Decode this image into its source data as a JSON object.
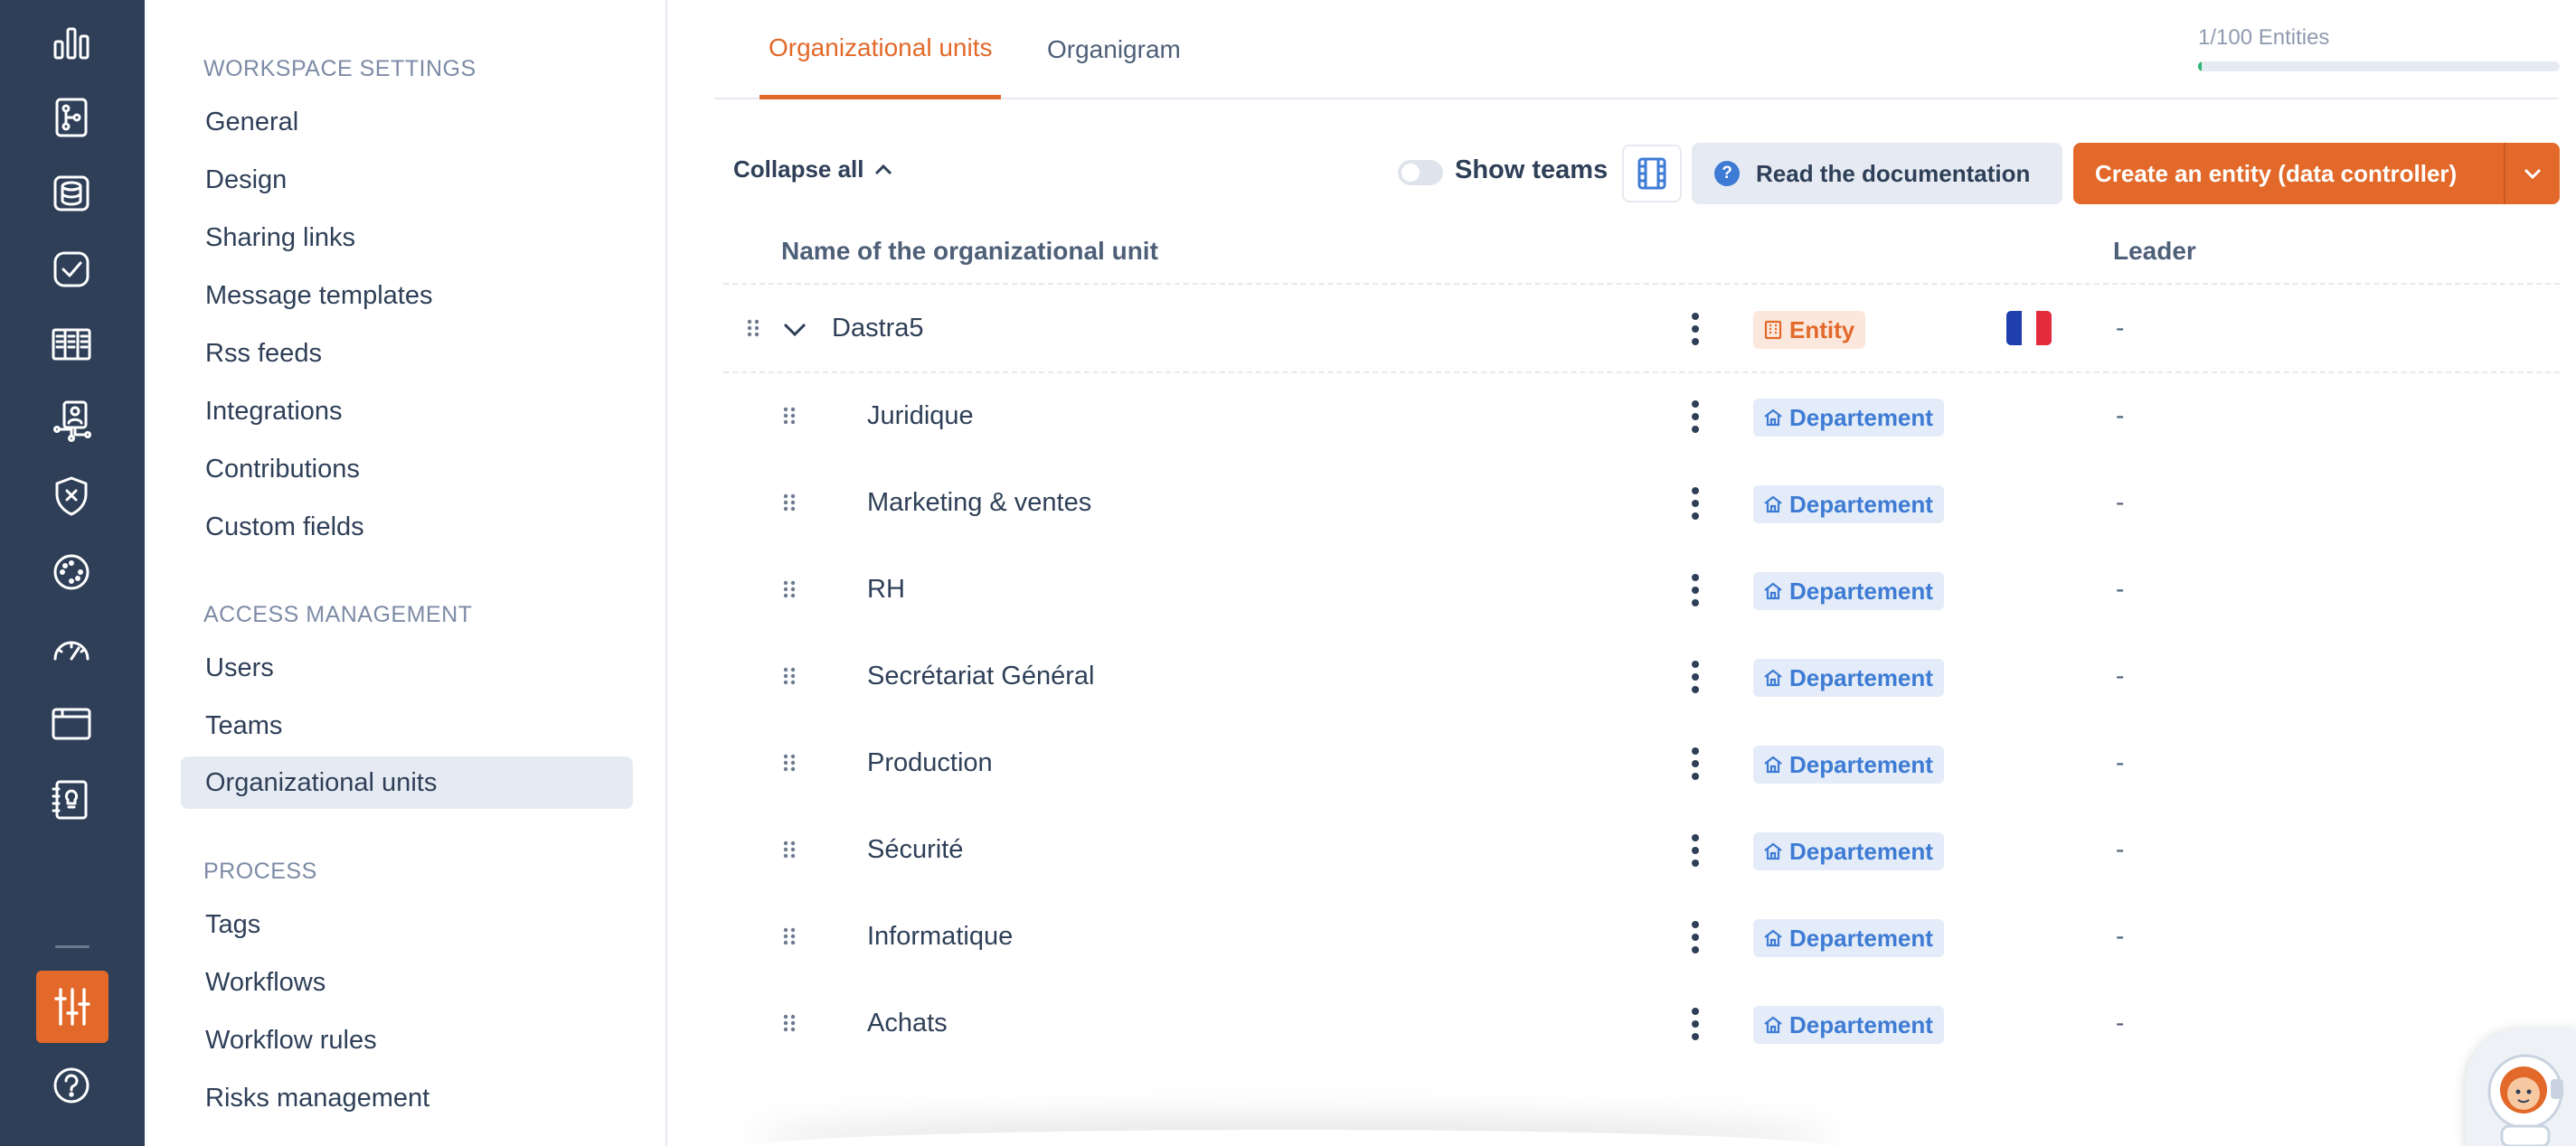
{
  "settings_nav": {
    "sections": [
      {
        "title": "WORKSPACE SETTINGS",
        "items": [
          "General",
          "Design",
          "Sharing links",
          "Message templates",
          "Rss feeds",
          "Integrations",
          "Contributions",
          "Custom fields"
        ]
      },
      {
        "title": "ACCESS MANAGEMENT",
        "items": [
          "Users",
          "Teams",
          "Organizational units"
        ]
      },
      {
        "title": "PROCESS",
        "items": [
          "Tags",
          "Workflows",
          "Workflow rules",
          "Risks management"
        ]
      }
    ],
    "active_item": "Organizational units"
  },
  "tabs": [
    "Organizational units",
    "Organigram"
  ],
  "active_tab": "Organizational units",
  "quota": {
    "label": "1/100 Entities",
    "used": 1,
    "max": 100
  },
  "toolbar": {
    "collapse_all": "Collapse all",
    "show_teams": "Show teams",
    "show_teams_on": false,
    "read_docs": "Read the documentation",
    "create_entity": "Create an entity (data controller)"
  },
  "table": {
    "headers": {
      "name": "Name of the organizational unit",
      "leader": "Leader"
    },
    "rows": [
      {
        "name": "Dastra5",
        "type": "Entity",
        "leader": "-",
        "country": "FR",
        "expanded": true
      },
      {
        "name": "Juridique",
        "type": "Departement",
        "leader": "-"
      },
      {
        "name": "Marketing & ventes",
        "type": "Departement",
        "leader": "-"
      },
      {
        "name": "RH",
        "type": "Departement",
        "leader": "-"
      },
      {
        "name": "Secrétariat Général",
        "type": "Departement",
        "leader": "-"
      },
      {
        "name": "Production",
        "type": "Departement",
        "leader": "-"
      },
      {
        "name": "Sécurité",
        "type": "Departement",
        "leader": "-"
      },
      {
        "name": "Informatique",
        "type": "Departement",
        "leader": "-"
      },
      {
        "name": "Achats",
        "type": "Departement",
        "leader": "-"
      }
    ]
  },
  "colors": {
    "sidebar_bg": "#2e3f57",
    "accent": "#e2692a",
    "department_blue": "#3d7bd4",
    "progress_green": "#2bb673"
  },
  "rail_icons": [
    "dashboard-icon",
    "data-mapping-icon",
    "database-icon",
    "checklist-icon",
    "registry-icon",
    "organization-icon",
    "security-incident-icon",
    "compass-icon",
    "gauge-icon",
    "folder-icon",
    "ideas-notebook-icon",
    "settings-sliders-icon",
    "help-icon"
  ]
}
